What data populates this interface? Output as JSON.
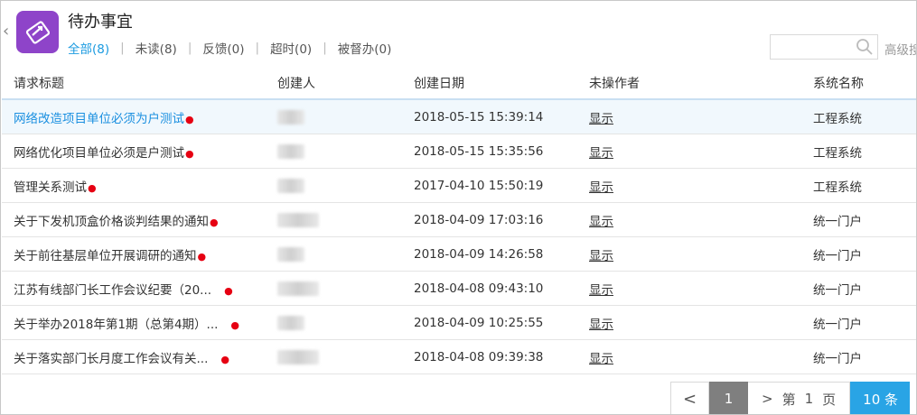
{
  "header": {
    "title": "待办事宜",
    "tabs": [
      {
        "label": "全部(8)",
        "active": true
      },
      {
        "label": "未读(8)"
      },
      {
        "label": "反馈(0)"
      },
      {
        "label": "超时(0)"
      },
      {
        "label": "被督办(0)"
      }
    ],
    "search_placeholder": "",
    "advanced_label": "高级搜"
  },
  "table": {
    "columns": [
      "请求标题",
      "创建人",
      "创建日期",
      "未操作者",
      "系统名称"
    ],
    "rows": [
      {
        "title": "网络改造项目单位必须为户测试",
        "date": "2018-05-15 15:39:14",
        "operator": "显示",
        "system": "工程系统"
      },
      {
        "title": "网络优化项目单位必须是户测试",
        "date": "2018-05-15 15:35:56",
        "operator": "显示",
        "system": "工程系统"
      },
      {
        "title": "管理关系测试",
        "date": "2017-04-10 15:50:19",
        "operator": "显示",
        "system": "工程系统"
      },
      {
        "title": "关于下发机顶盒价格谈判结果的通知",
        "date": "2018-04-09 17:03:16",
        "operator": "显示",
        "system": "统一门户"
      },
      {
        "title": "关于前往基层单位开展调研的通知",
        "date": "2018-04-09 14:26:58",
        "operator": "显示",
        "system": "统一门户"
      },
      {
        "title": "江苏有线部门长工作会议纪要（20...",
        "date": "2018-04-08 09:43:10",
        "operator": "显示",
        "system": "统一门户"
      },
      {
        "title": "关于举办2018年第1期（总第4期）...",
        "date": "2018-04-09 10:25:55",
        "operator": "显示",
        "system": "统一门户"
      },
      {
        "title": "关于落实部门长月度工作会议有关...",
        "date": "2018-04-08 09:39:38",
        "operator": "显示",
        "system": "统一门户"
      }
    ]
  },
  "pager": {
    "prev": "<",
    "current": "1",
    "next": ">",
    "di": "第",
    "page_num": "1",
    "ye": "页",
    "size_label": "10 条"
  },
  "colors": {
    "accent": "#1a9ae0",
    "unread_dot": "#e60012",
    "app_icon": "#8e44c9",
    "pager_active": "#29a4e5"
  }
}
